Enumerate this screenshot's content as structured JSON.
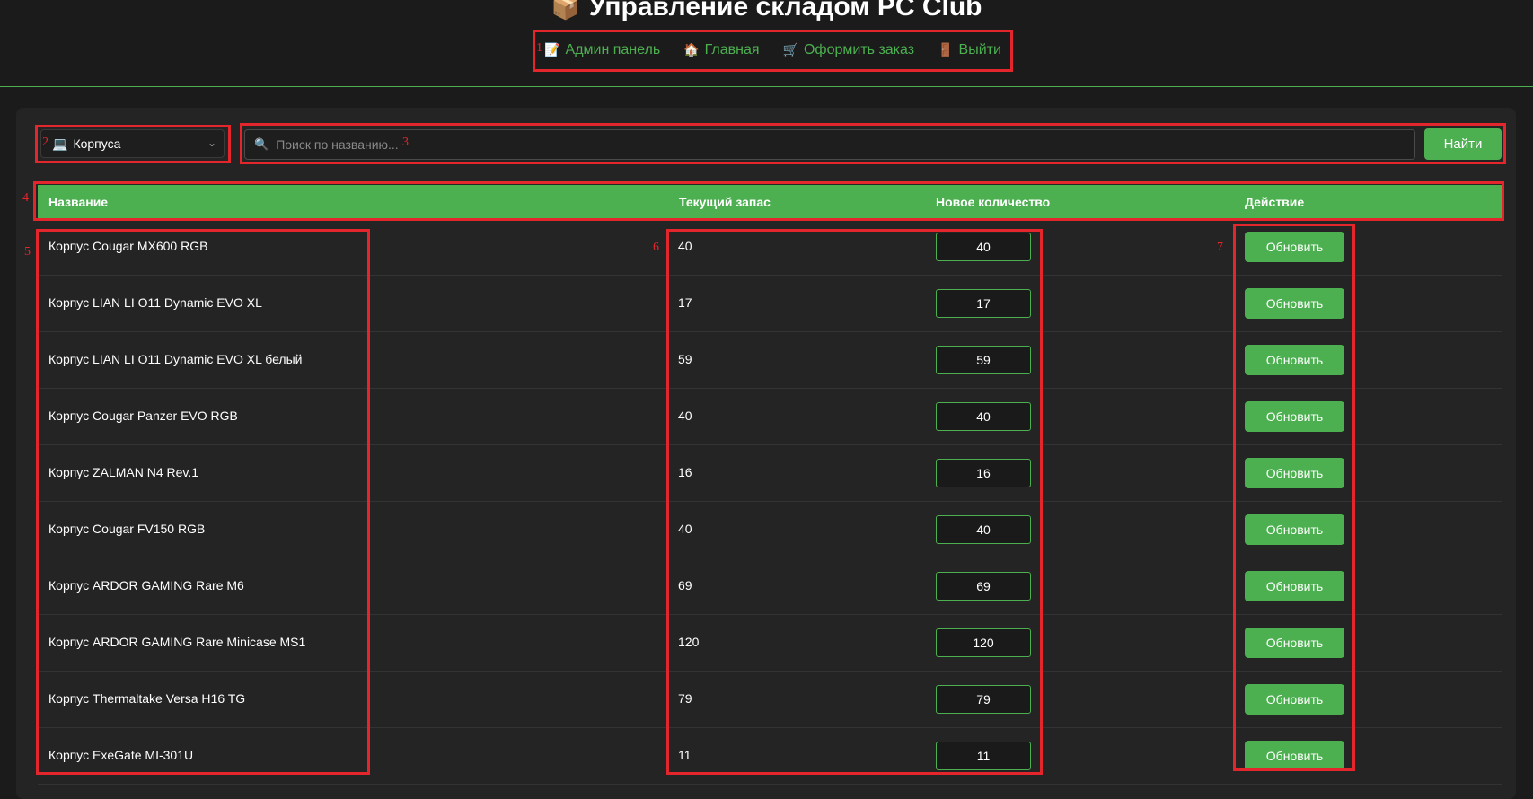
{
  "header": {
    "title": "Управление складом PC Club",
    "title_icon": "package-icon",
    "nav": [
      {
        "label": "Админ панель",
        "icon": "memo-icon",
        "glyph": "📝"
      },
      {
        "label": "Главная",
        "icon": "house-icon",
        "glyph": "🏠"
      },
      {
        "label": "Оформить заказ",
        "icon": "cart-icon",
        "glyph": "🛒"
      },
      {
        "label": "Выйти",
        "icon": "door-icon",
        "glyph": "🚪"
      }
    ]
  },
  "filters": {
    "category_selected": "Корпуса",
    "category_icon": "computer-icon",
    "search_placeholder": "Поиск по названию...",
    "search_icon": "magnifier-icon",
    "search_button": "Найти"
  },
  "table": {
    "columns": [
      "Название",
      "Текущий запас",
      "Новое количество",
      "Действие"
    ],
    "action_label": "Обновить",
    "rows": [
      {
        "name": "Корпус Cougar MX600 RGB",
        "stock": "40",
        "new_qty": "40"
      },
      {
        "name": "Корпус LIAN LI O11 Dynamic EVO XL",
        "stock": "17",
        "new_qty": "17"
      },
      {
        "name": "Корпус LIAN LI O11 Dynamic EVO XL белый",
        "stock": "59",
        "new_qty": "59"
      },
      {
        "name": "Корпус Cougar Panzer EVO RGB",
        "stock": "40",
        "new_qty": "40"
      },
      {
        "name": "Корпус ZALMAN N4 Rev.1",
        "stock": "16",
        "new_qty": "16"
      },
      {
        "name": "Корпус Cougar FV150 RGB",
        "stock": "40",
        "new_qty": "40"
      },
      {
        "name": "Корпус ARDOR GAMING Rare M6",
        "stock": "69",
        "new_qty": "69"
      },
      {
        "name": "Корпус ARDOR GAMING Rare Minicase MS1",
        "stock": "120",
        "new_qty": "120"
      },
      {
        "name": "Корпус Thermaltake Versa H16 TG",
        "stock": "79",
        "new_qty": "79"
      },
      {
        "name": "Корпус ExeGate MI-301U",
        "stock": "11",
        "new_qty": "11"
      }
    ]
  },
  "annotations": [
    "1",
    "2",
    "3",
    "4",
    "5",
    "6",
    "7"
  ],
  "colors": {
    "accent": "#4caf50",
    "background": "#1b1b1b",
    "panel": "#242424",
    "annotation": "#e3262b"
  }
}
